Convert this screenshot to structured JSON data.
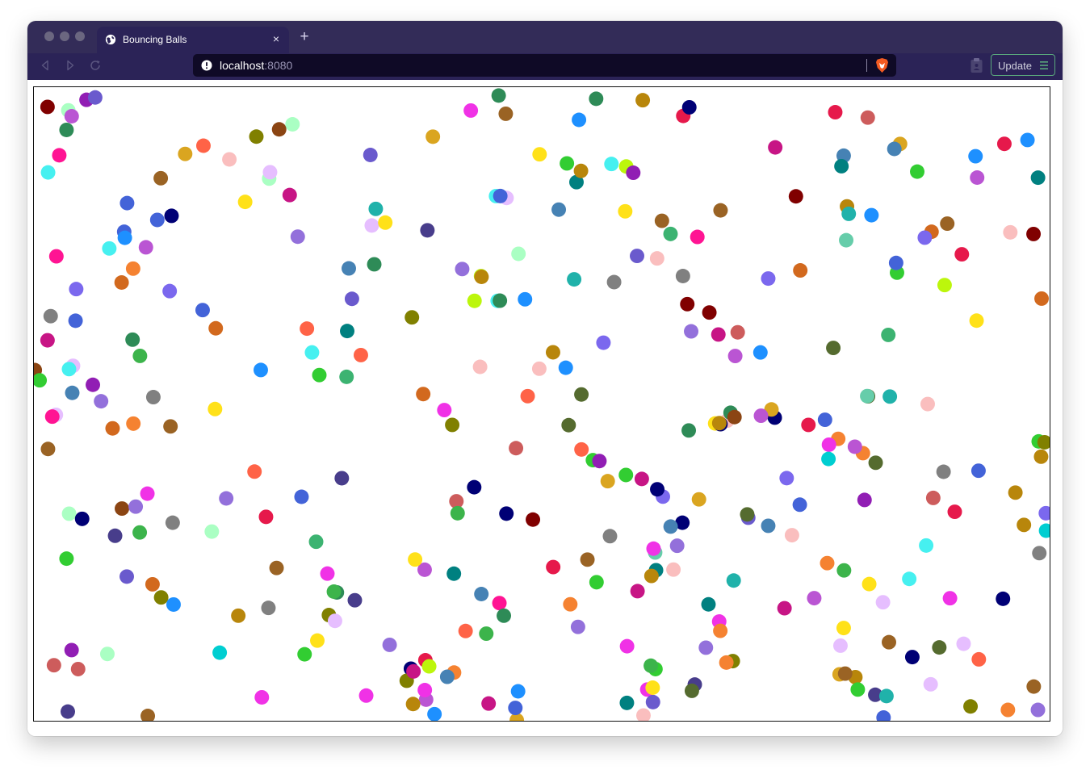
{
  "browser": {
    "tab": {
      "title": "Bouncing Balls",
      "favicon": "globe-icon",
      "close_icon": "close-icon",
      "close_glyph": "×"
    },
    "new_tab_icon": "plus-icon",
    "new_tab_glyph": "+",
    "nav": {
      "back": "back-icon",
      "forward": "forward-icon",
      "reload": "reload-icon"
    },
    "address": {
      "host": "localhost",
      "port": ":8080",
      "info_icon": "info-icon",
      "shield_icon": "brave-shield-icon"
    },
    "clipboard_icon": "clipboard-icon",
    "update_button": {
      "label": "Update",
      "icon": "menu-icon",
      "border_color": "#5aa97c"
    },
    "colors": {
      "titlebar": "#332c58",
      "toolbar": "#2b2357",
      "urlbar": "#0f0a26"
    }
  },
  "page": {
    "canvas": "bouncing-balls-canvas",
    "background": "#ffffff",
    "border_color": "#111111",
    "ball_count": 340,
    "ball_radius": 9,
    "palette": [
      "#e6194b",
      "#3cb44b",
      "#ffe119",
      "#4363d8",
      "#f58231",
      "#911eb4",
      "#46f0f0",
      "#f032e6",
      "#bcf60c",
      "#fabebe",
      "#008080",
      "#e6beff",
      "#9a6324",
      "#800000",
      "#aaffc3",
      "#808000",
      "#000075",
      "#808080",
      "#c71585",
      "#1e90ff",
      "#20b2aa",
      "#32cd32",
      "#ff6347",
      "#6a5acd",
      "#daa520",
      "#2e8b57",
      "#ba55d3",
      "#00ced1",
      "#ff1493",
      "#8b4513",
      "#556b2f",
      "#483d8b",
      "#7b68ee",
      "#b8860b",
      "#66cdaa",
      "#cd5c5c",
      "#9370db",
      "#3cb371",
      "#4682b4",
      "#d2691e"
    ]
  }
}
